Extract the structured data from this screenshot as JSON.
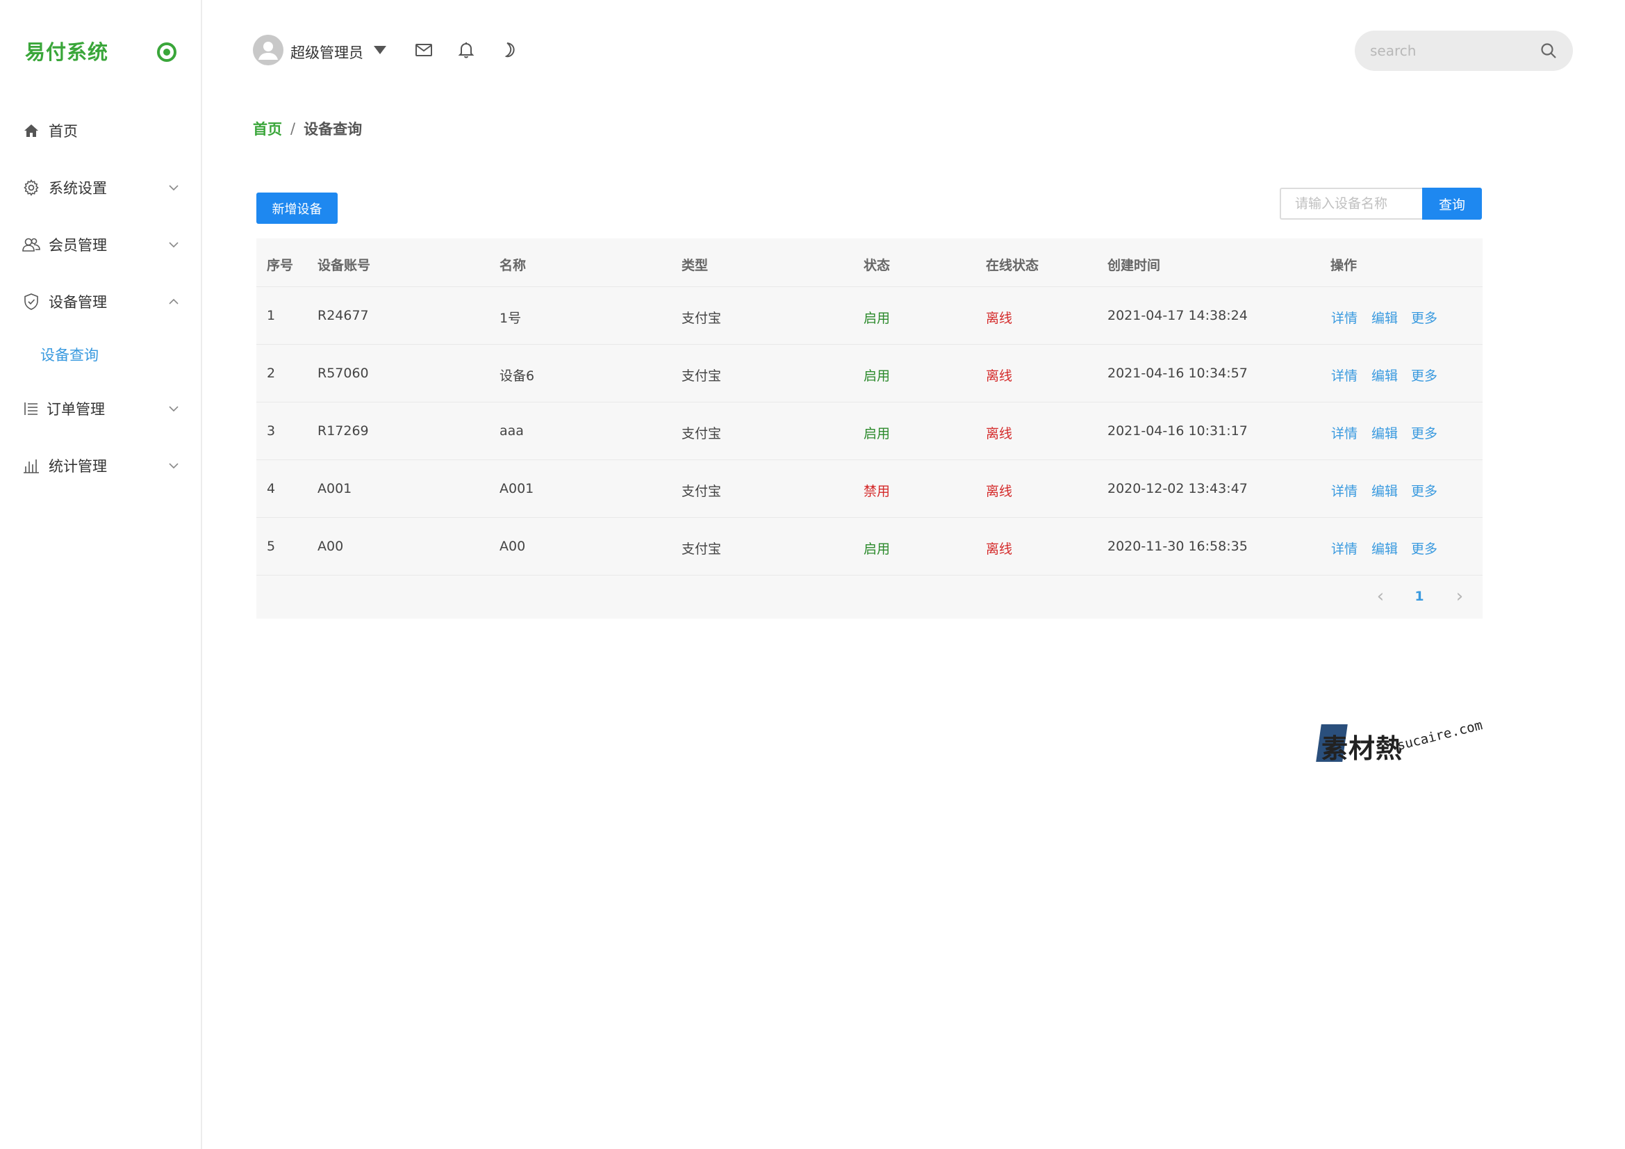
{
  "app": {
    "logo_text": "易付系统",
    "accent_color": "#3aa63a",
    "primary_color": "#1e88f0"
  },
  "sidebar": {
    "items": [
      {
        "label": "首页",
        "icon": "home-icon"
      },
      {
        "label": "系统设置",
        "icon": "gear-icon",
        "expandable": true,
        "expanded": false
      },
      {
        "label": "会员管理",
        "icon": "users-icon",
        "expandable": true,
        "expanded": false
      },
      {
        "label": "设备管理",
        "icon": "shield-icon",
        "expandable": true,
        "expanded": true
      },
      {
        "label": "订单管理",
        "icon": "list-icon",
        "expandable": true,
        "expanded": false
      },
      {
        "label": "统计管理",
        "icon": "bar-chart-icon",
        "expandable": true,
        "expanded": false
      }
    ],
    "subitems": [
      {
        "label": "设备查询",
        "active": true
      }
    ]
  },
  "header": {
    "user_name": "超级管理员",
    "icons": [
      "mail-icon",
      "bell-icon",
      "moon-icon"
    ],
    "search_placeholder": "search"
  },
  "breadcrumb": {
    "home": "首页",
    "separator": "/",
    "current": "设备查询"
  },
  "toolbar": {
    "add_label": "新增设备",
    "query_placeholder": "请输入设备名称",
    "query_label": "查询"
  },
  "table": {
    "columns": [
      "序号",
      "设备账号",
      "名称",
      "类型",
      "状态",
      "在线状态",
      "创建时间",
      "操作"
    ],
    "rows": [
      {
        "no": "1",
        "account": "R24677",
        "name": "1号",
        "type": "支付宝",
        "status": "启用",
        "status_on": true,
        "online": "离线",
        "created": "2021-04-17 14:38:24"
      },
      {
        "no": "2",
        "account": "R57060",
        "name": "设备6",
        "type": "支付宝",
        "status": "启用",
        "status_on": true,
        "online": "离线",
        "created": "2021-04-16 10:34:57"
      },
      {
        "no": "3",
        "account": "R17269",
        "name": "aaa",
        "type": "支付宝",
        "status": "启用",
        "status_on": true,
        "online": "离线",
        "created": "2021-04-16 10:31:17"
      },
      {
        "no": "4",
        "account": "A001",
        "name": "A001",
        "type": "支付宝",
        "status": "禁用",
        "status_on": false,
        "online": "离线",
        "created": "2020-12-02 13:43:47"
      },
      {
        "no": "5",
        "account": "A00",
        "name": "A00",
        "type": "支付宝",
        "status": "启用",
        "status_on": true,
        "online": "离线",
        "created": "2020-11-30 16:58:35"
      }
    ],
    "actions": [
      "详情",
      "编辑",
      "更多"
    ]
  },
  "pagination": {
    "prev": "‹",
    "current_page": "1",
    "next": "›"
  },
  "watermark": {
    "cn": "素材熱",
    "en": "sucaire.com"
  }
}
